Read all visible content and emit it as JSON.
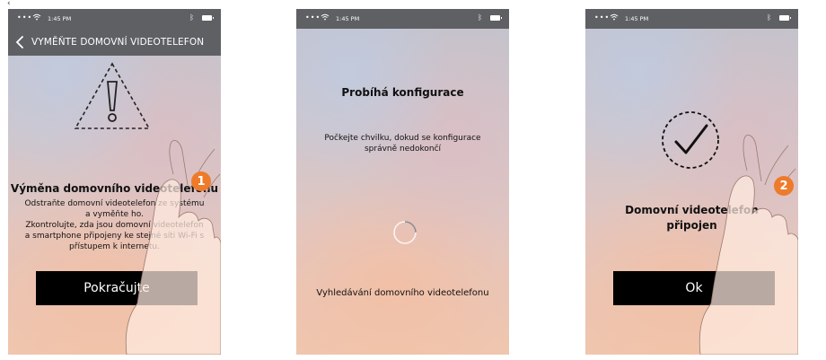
{
  "status_bar": {
    "time": "1:45 PM"
  },
  "screens": [
    {
      "nav_title": "VYMĚŇTE DOMOVNÍ VIDEOTELEFON",
      "heading": "Výměna domovního videotelefonu",
      "body_lines": [
        "Odstraňte domovní videotelefon ze systému",
        "a vyměňte ho.",
        "Zkontrolujte, zda jsou domovní videotelefon",
        "a smartphone připojeny ke stejné síti Wi-Fi s",
        "přístupem k internetu."
      ],
      "button_label": "Pokračujte",
      "badge": "1"
    },
    {
      "heading": "Probíhá konfigurace",
      "body_lines": [
        "Počkejte chvilku, dokud se konfigurace",
        "správně nedokončí"
      ],
      "searching_text": "Vyhledávání domovního videotelefonu"
    },
    {
      "heading_lines": [
        "Domovní videotelefon",
        "připojen"
      ],
      "button_label": "Ok",
      "badge": "2"
    }
  ]
}
